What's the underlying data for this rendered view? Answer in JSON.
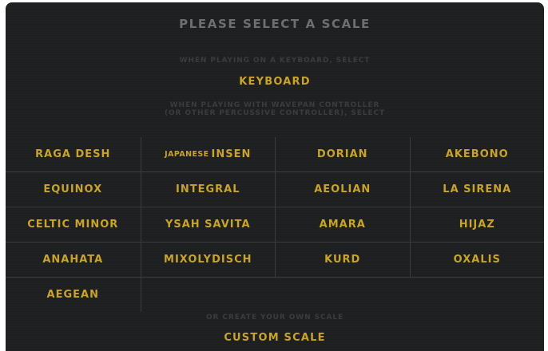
{
  "title": "PLEASE SELECT A SCALE",
  "keyboard_hint": "WHEN PLAYING ON A KEYBOARD, SELECT",
  "keyboard_link": "KEYBOARD",
  "wavepan_hint_line1": "WHEN PLAYING WITH WAVEPAN CONTROLLER",
  "wavepan_hint_line2": "(OR OTHER PERCUSSIVE CONTROLLER), SELECT",
  "scales": {
    "raga_desh": "RAGA DESH",
    "japanese_insen_prefix": "JAPANESE",
    "japanese_insen_main": "INSEN",
    "dorian": "DORIAN",
    "akebono": "AKEBONO",
    "equinox": "EQUINOX",
    "integral": "INTEGRAL",
    "aeolian": "AEOLIAN",
    "la_sirena": "LA SIRENA",
    "celtic_minor": "CELTIC MINOR",
    "ysah_savita": "YSAH SAVITA",
    "amara": "AMARA",
    "hijaz": "HIJAZ",
    "anahata": "ANAHATA",
    "mixolydisch": "MIXOLYDISCH",
    "kurd": "KURD",
    "oxalis": "OXALIS",
    "aegean": "AEGEAN"
  },
  "custom_hint": "OR CREATE YOUR OWN SCALE",
  "custom_link": "CUSTOM SCALE",
  "colors": {
    "background": "#1d1f20",
    "accent": "#c9a425",
    "title": "#6f6f6f",
    "hint": "#3a3c3d",
    "divider": "#3a3c3d"
  }
}
